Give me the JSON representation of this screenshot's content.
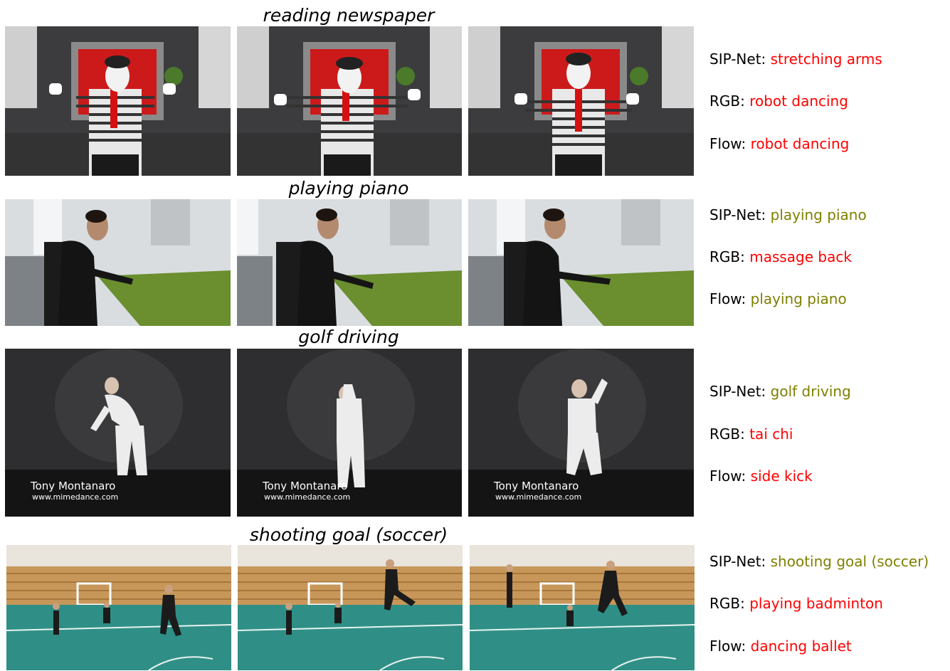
{
  "colors": {
    "correct": "#7f7f00",
    "wrong": "#ff0000"
  },
  "rows": [
    {
      "title": "reading newspaper",
      "predictions": [
        {
          "label": "SIP-Net: ",
          "value": "stretching arms",
          "status": "wrong"
        },
        {
          "label": "RGB: ",
          "value": "robot dancing",
          "status": "wrong"
        },
        {
          "label": "Flow: ",
          "value": "robot dancing",
          "status": "wrong"
        }
      ]
    },
    {
      "title": "playing piano",
      "predictions": [
        {
          "label": "SIP-Net: ",
          "value": "playing piano",
          "status": "correct"
        },
        {
          "label": "RGB: ",
          "value": "massage back",
          "status": "wrong"
        },
        {
          "label": "Flow: ",
          "value": "playing piano",
          "status": "correct"
        }
      ]
    },
    {
      "title": "golf driving",
      "watermark_name": "Tony Montanaro",
      "watermark_url": "www.mimedance.com",
      "predictions": [
        {
          "label": "SIP-Net: ",
          "value": "golf driving",
          "status": "correct"
        },
        {
          "label": "RGB: ",
          "value": "tai chi",
          "status": "wrong"
        },
        {
          "label": "Flow: ",
          "value": "side kick",
          "status": "wrong"
        }
      ]
    },
    {
      "title": "shooting goal (soccer)",
      "predictions": [
        {
          "label": "SIP-Net: ",
          "value": "shooting goal (soccer)",
          "status": "correct"
        },
        {
          "label": "RGB: ",
          "value": "playing badminton",
          "status": "wrong"
        },
        {
          "label": "Flow: ",
          "value": "dancing ballet",
          "status": "wrong"
        }
      ]
    }
  ]
}
